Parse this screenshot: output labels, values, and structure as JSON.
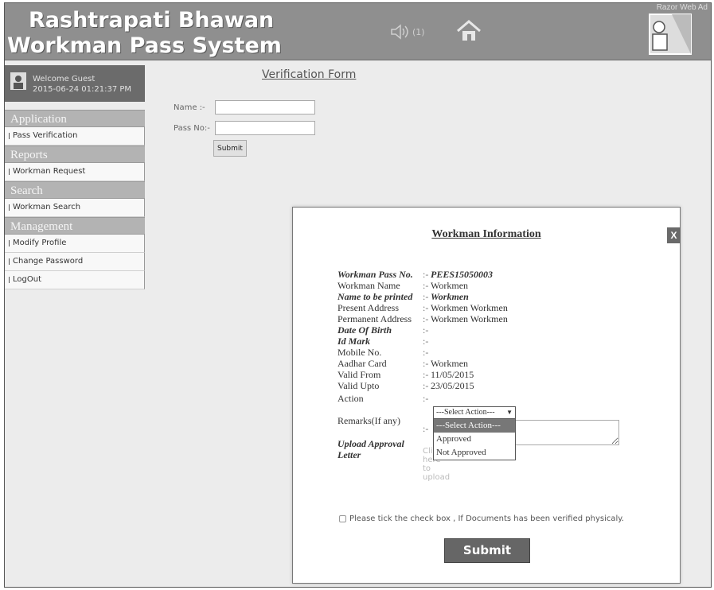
{
  "header": {
    "title_line1": "Rashtrapati Bhawan",
    "title_line2": "Workman Pass System",
    "sound_text": "(1)",
    "ad_label": "Razor Web Ad"
  },
  "welcome": {
    "greeting": "Welcome Guest",
    "datetime": "2015-06-24 01:21:37 PM"
  },
  "sidebar": {
    "sections": [
      {
        "title": "Application",
        "items": [
          "Pass Verification"
        ]
      },
      {
        "title": "Reports",
        "items": [
          "Workman Request"
        ]
      },
      {
        "title": "Search",
        "items": [
          "Workman Search"
        ]
      },
      {
        "title": "Management",
        "items": [
          "Modify Profile",
          "Change Password",
          "LogOut"
        ]
      }
    ]
  },
  "form": {
    "title": "Verification Form",
    "name_label": "Name  :-",
    "name_value": "",
    "pass_label": "Pass No:-",
    "pass_value": "",
    "submit_label": "Submit"
  },
  "modal": {
    "title": "Workman Information",
    "close_label": "X",
    "rows": [
      {
        "key": "Workman Pass No.",
        "value": "PEES15050003",
        "bold": true
      },
      {
        "key": "Workman Name",
        "value": "Workmen",
        "bold": false
      },
      {
        "key": "Name to be printed",
        "value": "Workmen",
        "bold": true
      },
      {
        "key": "Present Address",
        "value": "Workmen Workmen",
        "bold": false
      },
      {
        "key": "Permanent Address",
        "value": "Workmen Workmen",
        "bold": false
      },
      {
        "key": "Date Of Birth",
        "value": "",
        "bold": true
      },
      {
        "key": "Id Mark",
        "value": "",
        "bold": true
      },
      {
        "key": "Mobile No.",
        "value": "",
        "bold": false
      },
      {
        "key": "Aadhar Card",
        "value": "Workmen",
        "bold": false
      },
      {
        "key": "Valid From",
        "value": "11/05/2015",
        "bold": false
      },
      {
        "key": "Valid Upto",
        "value": "23/05/2015",
        "bold": false
      },
      {
        "key": "Action",
        "value": "",
        "bold": false
      }
    ],
    "separator": ":-",
    "remarks_label": "Remarks(If any)",
    "upload_label_line1": "Upload Approval",
    "upload_label_line2": "Letter",
    "upload_placeholder": "Click here to upload",
    "action_select": {
      "selected": "---Select Action---",
      "options": [
        "---Select Action---",
        "Approved",
        "Not Approved"
      ]
    },
    "checkbox_text": "Please tick the check box , If Documents has been verified physicaly.",
    "submit_label": "Submit"
  }
}
